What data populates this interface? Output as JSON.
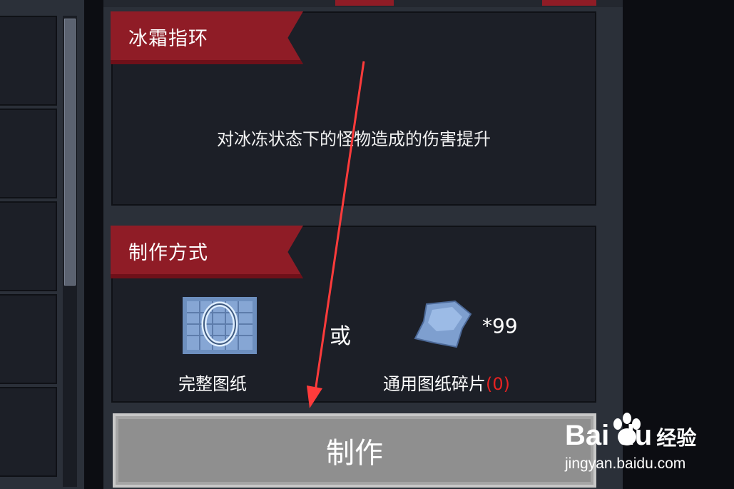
{
  "item": {
    "name": "冰霜指环",
    "description": "对冰冻状态下的怪物造成的伤害提升"
  },
  "recipe": {
    "section_title": "制作方式",
    "option_a": {
      "label": "完整图纸",
      "icon": "ring-blueprint-icon"
    },
    "separator": "或",
    "option_b": {
      "label": "通用图纸碎片",
      "owned": "(0)",
      "required": "*99",
      "icon": "blueprint-fragment-icon"
    }
  },
  "craft_button": {
    "label": "制作"
  },
  "watermark": {
    "logo": "Bai  du",
    "logo_cn": "经验",
    "url": "jingyan.baidu.com"
  },
  "colors": {
    "ribbon": "#8f1c26",
    "panel": "#2b3039",
    "section": "#1c1f27",
    "button": "#8f8f8f",
    "warning": "#e52222"
  }
}
